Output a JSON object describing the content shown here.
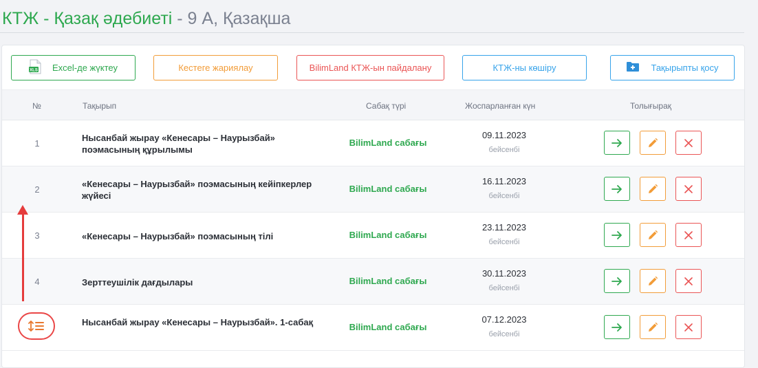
{
  "header": {
    "title_main": "КТЖ - Қазақ әдебиеті",
    "title_rest": " - 9 А, Қазақша"
  },
  "toolbar": {
    "excel_label": "Excel-де жүктеу",
    "excel_icon": "excel-file-icon",
    "publish_label": "Кестеге жариялау",
    "bilimland_label": "BilimLand КТЖ-ын пайдалану",
    "copy_label": "КТЖ-ны көшіру",
    "add_topic_label": "Тақырыпты қосу",
    "add_topic_icon": "folder-plus-icon"
  },
  "table": {
    "headers": {
      "num": "№",
      "topic": "Тақырып",
      "type": "Сабақ түрі",
      "date": "Жоспарланған күн",
      "more": "Толығырақ"
    },
    "rows": [
      {
        "num": "1",
        "topic": "Нысанбай жырау «Кенесары – Наурызбай» поэмасының құрылымы",
        "type": "BilimLand сабағы",
        "date": "09.11.2023",
        "day": "бейсенбі"
      },
      {
        "num": "2",
        "topic": "«Кенесары – Наурызбай» поэмасының кейіпкерлер жүйесі",
        "type": "BilimLand сабағы",
        "date": "16.11.2023",
        "day": "бейсенбі"
      },
      {
        "num": "3",
        "topic": "«Кенесары – Наурызбай» поэмасының тілі",
        "type": "BilimLand сабағы",
        "date": "23.11.2023",
        "day": "бейсенбі"
      },
      {
        "num": "4",
        "topic": "Зерттеушілік дағдылары",
        "type": "BilimLand сабағы",
        "date": "30.11.2023",
        "day": "бейсенбі"
      },
      {
        "num": "",
        "topic": "Нысанбай жырау «Кенесары – Наурызбай». 1-сабақ",
        "type": "BilimLand сабағы",
        "date": "07.12.2023",
        "day": "бейсенбі"
      }
    ]
  },
  "icons": {
    "go": "arrow-right-icon",
    "edit": "pencil-icon",
    "delete": "close-icon",
    "sort": "sort-order-icon"
  },
  "colors": {
    "green": "#2ea84f",
    "orange": "#f29c38",
    "red": "#ea5454",
    "blue": "#36a3ea",
    "annotation_red": "#e53c3c"
  }
}
